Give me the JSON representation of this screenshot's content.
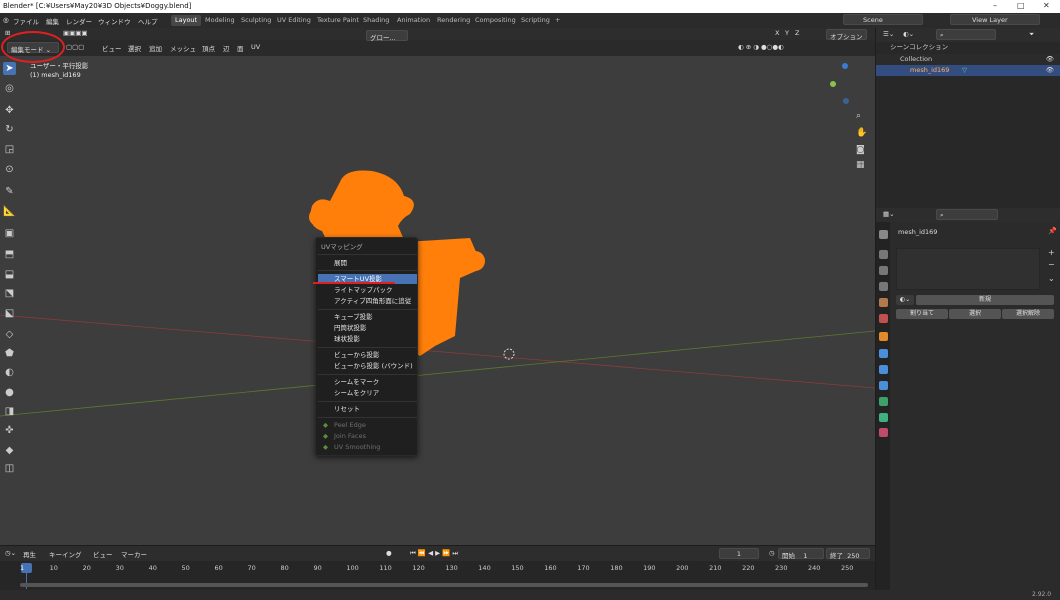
{
  "window": {
    "title": "Blender* [C:¥Users¥May20¥3D Objects¥Doggy.blend]",
    "min": "–",
    "max": "□",
    "close": "✕"
  },
  "menu": [
    "ファイル",
    "編集",
    "レンダー",
    "ウィンドウ",
    "ヘルプ"
  ],
  "workspaces": [
    "Layout",
    "Modeling",
    "Sculpting",
    "UV Editing",
    "Texture Paint",
    "Shading",
    "Animation",
    "Rendering",
    "Compositing",
    "Scripting",
    "+"
  ],
  "active_workspace": "Layout",
  "scene": {
    "label": "Scene",
    "view_layer": "View Layer"
  },
  "header": {
    "mode": "編集モード",
    "menus": [
      "ビュー",
      "選択",
      "追加",
      "メッシュ",
      "頂点",
      "辺",
      "面",
      "UV"
    ],
    "transform_orient": "グロー...",
    "xyz": [
      "X",
      "Y",
      "Z"
    ],
    "options": "オプション"
  },
  "viewport": {
    "view_name": "ユーザー・平行投影",
    "object_name": "(1) mesh_id169"
  },
  "context_menu": {
    "title": "UVマッピング",
    "items": [
      {
        "label": "展開",
        "highlight": false,
        "disabled": false
      },
      {
        "label": "スマートUV投影",
        "highlight": true,
        "disabled": false
      },
      {
        "label": "ライトマップパック",
        "highlight": false,
        "disabled": false
      },
      {
        "label": "アクティブ四角形面に追従",
        "highlight": false,
        "disabled": false
      },
      {
        "label": "キューブ投影",
        "highlight": false,
        "disabled": false
      },
      {
        "label": "円筒状投影",
        "highlight": false,
        "disabled": false
      },
      {
        "label": "球状投影",
        "highlight": false,
        "disabled": false
      },
      {
        "label": "ビューから投影",
        "highlight": false,
        "disabled": false
      },
      {
        "label": "ビューから投影 (バウンド)",
        "highlight": false,
        "disabled": false
      },
      {
        "label": "シームをマーク",
        "highlight": false,
        "disabled": false
      },
      {
        "label": "シームをクリア",
        "highlight": false,
        "disabled": false
      },
      {
        "label": "リセット",
        "highlight": false,
        "disabled": false
      },
      {
        "label": "Peel Edge",
        "highlight": false,
        "disabled": true
      },
      {
        "label": "Join Faces",
        "highlight": false,
        "disabled": true
      },
      {
        "label": "UV Smoothing",
        "highlight": false,
        "disabled": true
      }
    ]
  },
  "outliner": {
    "title": "シーンコレクション",
    "collection": "Collection",
    "object": "mesh_id169"
  },
  "properties": {
    "object_name": "mesh_id169",
    "new_button": "新規",
    "assign": "割り当て",
    "select": "選択",
    "deselect": "選択解除"
  },
  "timeline": {
    "playback": "再生",
    "keying": "キーイング",
    "view": "ビュー",
    "marker": "マーカー",
    "current_frame": "1",
    "start_label": "開始",
    "start": "1",
    "end_label": "終了",
    "end": "250",
    "ticks": [
      "1",
      "10",
      "20",
      "30",
      "40",
      "50",
      "60",
      "70",
      "80",
      "90",
      "100",
      "110",
      "120",
      "130",
      "140",
      "150",
      "160",
      "170",
      "180",
      "190",
      "200",
      "210",
      "220",
      "230",
      "240",
      "250"
    ]
  },
  "status": {
    "version": "2.92.0"
  },
  "colors": {
    "accent": "#4772b3",
    "mesh": "#ff7f0a",
    "annotation": "#e02020"
  }
}
